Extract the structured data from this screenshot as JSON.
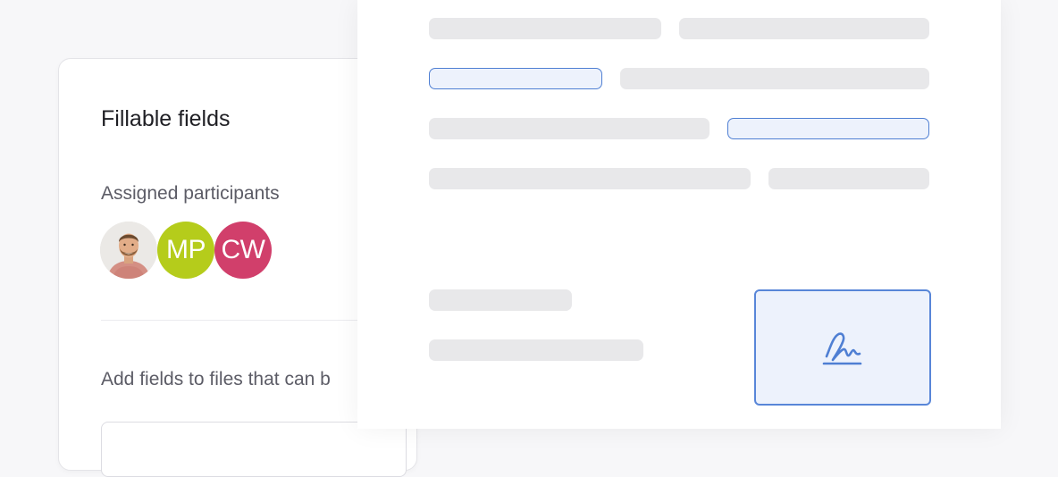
{
  "panel": {
    "title": "Fillable fields",
    "participants_label": "Assigned participants",
    "participants": [
      {
        "type": "photo",
        "name": "participant-photo"
      },
      {
        "type": "initials",
        "initials": "MP",
        "color": "#b5cc1b"
      },
      {
        "type": "initials",
        "initials": "CW",
        "color": "#d13f6b"
      }
    ],
    "help_text": "Add fields to files that can b"
  },
  "document": {
    "accent_color": "#4f7fd3",
    "signature_icon": "signature-icon"
  }
}
